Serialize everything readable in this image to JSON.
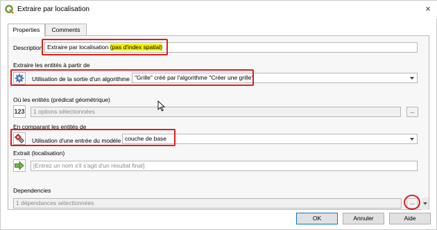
{
  "window": {
    "title": "Extraire par localisation",
    "close_label": "×"
  },
  "tabs": [
    {
      "label": "Properties"
    },
    {
      "label": "Comments"
    }
  ],
  "description": {
    "label": "Description",
    "value_plain": "Extraire par localisation ",
    "value_highlight": "(pas d'index spatial)"
  },
  "input_section": {
    "label": "Extraire les entités à partir de",
    "source_type": "Utilisation de la sortie d'un algorithme",
    "source_value": "\"Grille\" créé par l'algorithme \"Créer une grille\""
  },
  "predicate_section": {
    "label": "Où les entités (prédicat géométrique)",
    "icon_text": "123",
    "value": "1 options sélectionnées",
    "button_label": "..."
  },
  "compare_section": {
    "label": "En comparant les entités de",
    "source_type": "Utilisation d'une entrée du modèle",
    "source_value": "couche de base"
  },
  "output_section": {
    "label": "Extrait (localisation)",
    "placeholder": "[Entrez un nom s'il s'agit d'un résultat final]"
  },
  "dependencies": {
    "label": "Dependencies",
    "value": "1 dépendances sélectionnées",
    "button_label": "..."
  },
  "buttons": {
    "ok": "OK",
    "cancel": "Annuler",
    "help": "Aide"
  },
  "colors": {
    "accent": "#0078d7",
    "annotation_red": "#e01c1c",
    "highlight": "#f5f000"
  }
}
